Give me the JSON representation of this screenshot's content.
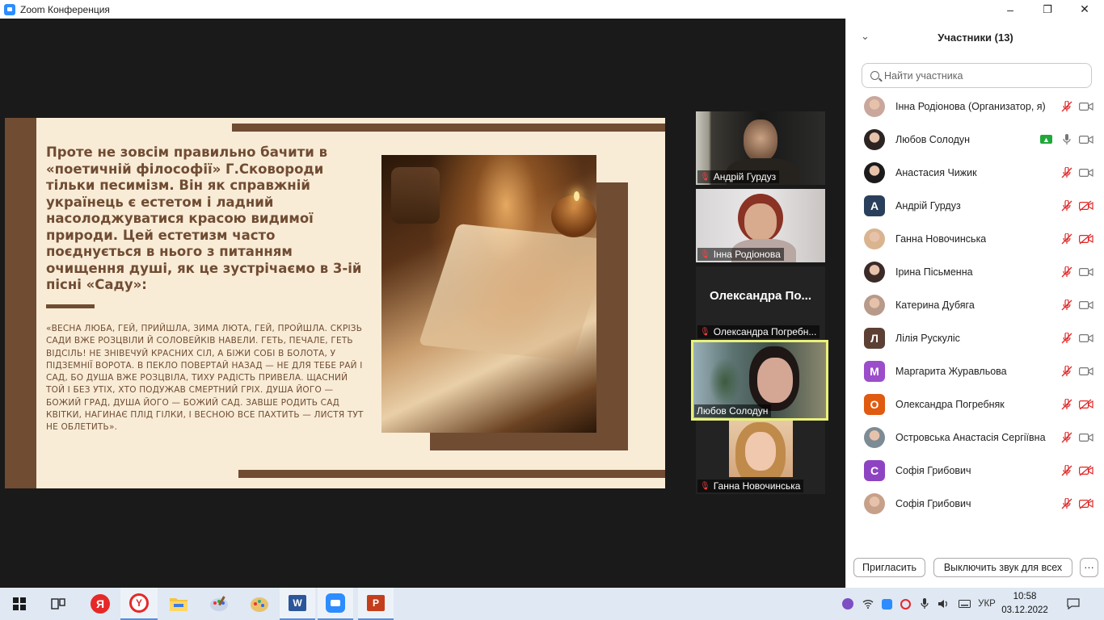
{
  "window": {
    "title": "Zoom Конференция",
    "minimize_label": "–",
    "restore_label": "❐",
    "close_label": "✕"
  },
  "slide": {
    "heading": "Проте не зовсім правильно бачити в «поетичній філософії» Г.Сковороди тільки песимізм. Він як справжній українець є естетом і ладний насолоджуватися красою видимої природи. Цей естетизм часто поєднується в нього з питанням очищення душі, як це зустрічаємо в 3-ій пісні «Саду»:",
    "quote": "«Весна люба, гей, прийшла, зима люта, гей, пройшла. Скрізь сади вже розцвіли й соловейків навели. Геть, печале, геть відсіль! Не знівечуй красних сіл, а біжи собі в болота, у підземнії ворота. В пекло повертай назад — не для тебе рай і сад, бо душа вже розцвіла, тиху радість привела. Щасний той і без утіх, хто подужав смертний гріх. Душа його — Божий град, душа його — Божий сад. Завше родить сад квітки, нагинає плід гілки, і весною все пахтить — листя тут не облетить»."
  },
  "videos": [
    {
      "name": "Андрій Гурдуз"
    },
    {
      "name": "Інна Родіонова"
    },
    {
      "name": "Олександра Погребн...",
      "display_name": "Олександра  По..."
    },
    {
      "name": "Любов Солодун"
    },
    {
      "name": "Ганна Новочинська"
    }
  ],
  "participants_panel": {
    "title": "Участники (13)",
    "search_placeholder": "Найти участника",
    "invite_label": "Пригласить",
    "mute_all_label": "Выключить звук для всех",
    "more_label": "···",
    "participants": [
      {
        "name": "Інна Родіонова (Организатор, я)",
        "avatar_type": "photo",
        "avatar_color": "#c9a79c",
        "mic": "muted",
        "cam": "on",
        "sharing": false
      },
      {
        "name": "Любов Солодун",
        "avatar_type": "photo",
        "avatar_color": "#2b2422",
        "mic": "on",
        "cam": "on",
        "sharing": true
      },
      {
        "name": "Анастасия Чижик",
        "avatar_type": "photo",
        "avatar_color": "#1c1a1a",
        "mic": "muted",
        "cam": "on",
        "sharing": false
      },
      {
        "name": "Андрій Гурдуз",
        "avatar_type": "letter",
        "avatar_letter": "А",
        "avatar_color": "#2a3f5c",
        "mic": "muted",
        "cam": "off",
        "sharing": false
      },
      {
        "name": "Ганна Новочинська",
        "avatar_type": "photo",
        "avatar_color": "#d9b48f",
        "mic": "muted",
        "cam": "off",
        "sharing": false
      },
      {
        "name": "Ірина Пісьменна",
        "avatar_type": "photo",
        "avatar_color": "#3a2a28",
        "mic": "muted",
        "cam": "on",
        "sharing": false
      },
      {
        "name": "Катерина Дубяга",
        "avatar_type": "photo",
        "avatar_color": "#b89a8a",
        "mic": "muted",
        "cam": "on",
        "sharing": false
      },
      {
        "name": "Лілія Рускуліс",
        "avatar_type": "letter",
        "avatar_letter": "Л",
        "avatar_color": "#5c4033",
        "mic": "muted",
        "cam": "on",
        "sharing": false
      },
      {
        "name": "Маргарита Журавльова",
        "avatar_type": "letter",
        "avatar_letter": "М",
        "avatar_color": "#9b4dca",
        "mic": "muted",
        "cam": "on",
        "sharing": false
      },
      {
        "name": "Олександра Погребняк",
        "avatar_type": "letter",
        "avatar_letter": "О",
        "avatar_color": "#e05a10",
        "mic": "muted",
        "cam": "off",
        "sharing": false
      },
      {
        "name": "Островська Анастасія Сергіївна",
        "avatar_type": "photo",
        "avatar_color": "#7d8b95",
        "mic": "muted",
        "cam": "on",
        "sharing": false
      },
      {
        "name": "Софія Грибович",
        "avatar_type": "letter",
        "avatar_letter": "С",
        "avatar_color": "#8e44c2",
        "mic": "muted",
        "cam": "off",
        "sharing": false
      },
      {
        "name": "Софія Грибович",
        "avatar_type": "photo",
        "avatar_color": "#c7a08a",
        "mic": "muted",
        "cam": "off",
        "sharing": false
      }
    ]
  },
  "taskbar": {
    "language": "УКР",
    "time": "10:58",
    "date": "03.12.2022",
    "apps": [
      "start-icon",
      "task-view-icon",
      "yandex-browser-icon",
      "yandex-icon",
      "file-explorer-icon",
      "paint-icon",
      "paint-3d-icon",
      "word-icon",
      "zoom-icon",
      "powerpoint-icon"
    ]
  },
  "colors": {
    "slide_brown": "#704c33",
    "slide_bg": "#f9ecd7",
    "active_speaker": "#e9f178",
    "muted_red": "#e02828",
    "share_green": "#1fa83a"
  }
}
